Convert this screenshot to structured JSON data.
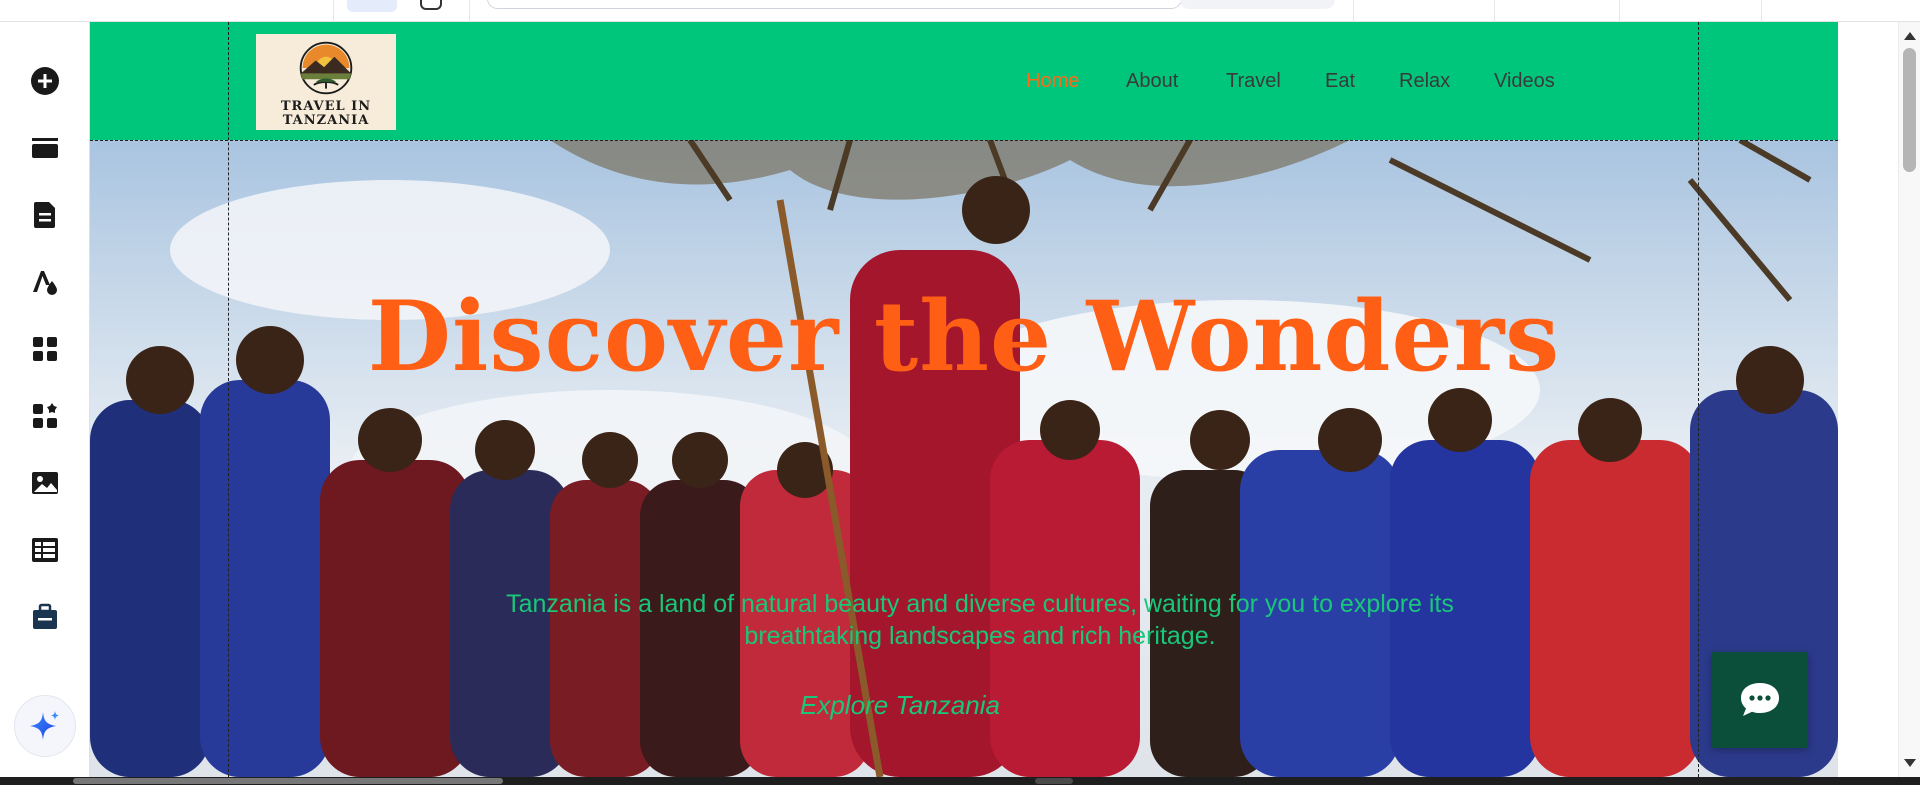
{
  "site": {
    "logo_text": "TRAVEL IN TANZANIA",
    "nav": [
      {
        "label": "Home",
        "active": true
      },
      {
        "label": "About",
        "active": false
      },
      {
        "label": "Travel",
        "active": false
      },
      {
        "label": "Eat",
        "active": false
      },
      {
        "label": "Relax",
        "active": false
      },
      {
        "label": "Videos",
        "active": false
      }
    ],
    "hero": {
      "title": "Discover the Wonders",
      "text": "Tanzania is a land of natural beauty and diverse cultures, waiting for you to explore its breathtaking landscapes and rich heritage.",
      "link": "Explore Tanzania"
    }
  },
  "sidebar": {
    "items": [
      {
        "icon": "add-circle-icon"
      },
      {
        "icon": "sections-icon"
      },
      {
        "icon": "pages-icon"
      },
      {
        "icon": "design-icon"
      },
      {
        "icon": "apps-icon"
      },
      {
        "icon": "app-market-icon"
      },
      {
        "icon": "media-icon"
      },
      {
        "icon": "cms-icon"
      },
      {
        "icon": "business-tools-icon"
      },
      {
        "icon": "ai-assistant-icon"
      }
    ]
  },
  "colors": {
    "header_bg": "#00c67c",
    "nav_active": "#ff6a17",
    "hero_title": "#ff5f15",
    "hero_text": "#19c77a",
    "chat_bg": "#0b4f3a"
  }
}
